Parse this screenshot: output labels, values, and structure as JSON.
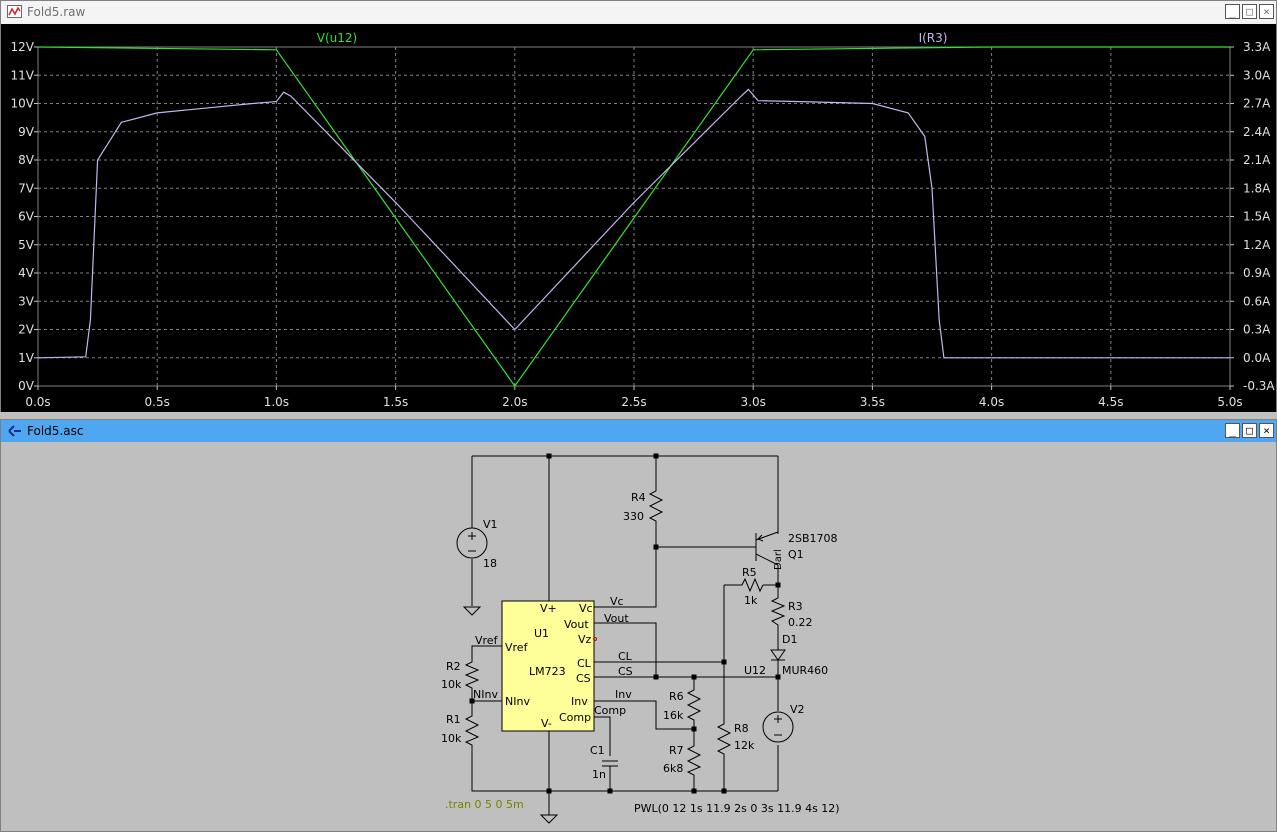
{
  "plot_window": {
    "title": "Fold5.raw",
    "traces": [
      {
        "name": "V(u12)",
        "color": "#33e233"
      },
      {
        "name": "I(R3)",
        "color": "#c8b4ee"
      }
    ],
    "left_axis_ticks": [
      "12V",
      "11V",
      "10V",
      "9V",
      "8V",
      "7V",
      "6V",
      "5V",
      "4V",
      "3V",
      "2V",
      "1V",
      "0V"
    ],
    "right_axis_ticks": [
      "3.3A",
      "3.0A",
      "2.7A",
      "2.4A",
      "2.1A",
      "1.8A",
      "1.5A",
      "1.2A",
      "0.9A",
      "0.6A",
      "0.3A",
      "0.0A",
      "-0.3A"
    ],
    "x_axis_ticks": [
      "0.0s",
      "0.5s",
      "1.0s",
      "1.5s",
      "2.0s",
      "2.5s",
      "3.0s",
      "3.5s",
      "4.0s",
      "4.5s",
      "5.0s"
    ]
  },
  "chart_data": {
    "type": "line",
    "xlim": [
      0,
      5
    ],
    "ylim": [
      0,
      12
    ],
    "y2lim": [
      -0.3,
      3.3
    ],
    "grid": true,
    "series": [
      {
        "name": "V(u12)",
        "axis": "left",
        "x": [
          0,
          1,
          2,
          3,
          4,
          5
        ],
        "y": [
          12,
          11.9,
          0,
          11.9,
          12,
          12
        ]
      },
      {
        "name": "I(R3)",
        "axis": "right",
        "x": [
          0,
          0.2,
          0.22,
          0.25,
          0.35,
          0.5,
          0.7,
          0.9,
          1.0,
          1.03,
          1.06,
          1.5,
          2.0,
          2.5,
          2.95,
          2.98,
          3.02,
          3.2,
          3.5,
          3.65,
          3.72,
          3.75,
          3.78,
          3.8,
          4.0,
          5.0
        ],
        "y": [
          0.0,
          0.01,
          0.4,
          2.1,
          2.5,
          2.6,
          2.65,
          2.7,
          2.72,
          2.82,
          2.78,
          1.65,
          0.3,
          1.65,
          2.78,
          2.85,
          2.73,
          2.72,
          2.7,
          2.6,
          2.35,
          1.8,
          0.4,
          0.0,
          0.0,
          0.0
        ]
      }
    ]
  },
  "schematic_window": {
    "title": "Fold5.asc",
    "labels": {
      "v1_name": "V1",
      "v1_value": "18",
      "r4_name": "R4",
      "r4_value": "330",
      "q1_part": "2SB1708",
      "q1_name": "Q1",
      "q1_model": "Darl",
      "r5_name": "R5",
      "r5_value": "1k",
      "r3_name": "R3",
      "r3_value": "0.22",
      "d1_name": "D1",
      "d1_part": "MUR460",
      "u1_name": "U1",
      "u1_part": "LM723",
      "pin_vplus": "V+",
      "pin_vc": "Vc",
      "pin_vout": "Vout",
      "pin_vz": "Vz",
      "pin_vref": "Vref",
      "pin_cl": "CL",
      "pin_cs": "CS",
      "pin_ninv": "NInv",
      "pin_inv": "Inv",
      "pin_comp": "Comp",
      "pin_vminus": "V-",
      "net_vc": "Vc",
      "net_vout": "Vout",
      "net_vref": "Vref",
      "net_cl": "CL",
      "net_cs": "CS",
      "net_ninv": "NInv",
      "net_inv": "Inv",
      "net_comp": "Comp",
      "net_u12": "U12",
      "r2_name": "R2",
      "r2_value": "10k",
      "r1_name": "R1",
      "r1_value": "10k",
      "r6_name": "R6",
      "r6_value": "16k",
      "r7_name": "R7",
      "r7_value": "6k8",
      "r8_name": "R8",
      "r8_value": "12k",
      "c1_name": "C1",
      "c1_value": "1n",
      "v2_name": "V2",
      "tran": ".tran 0 5 0 5m",
      "pwl": "PWL(0 12 1s 11.9 2s 0 3s 11.9 4s 12)"
    }
  },
  "window_buttons": {
    "minimize": "_",
    "maximize": "□",
    "close": "×"
  }
}
